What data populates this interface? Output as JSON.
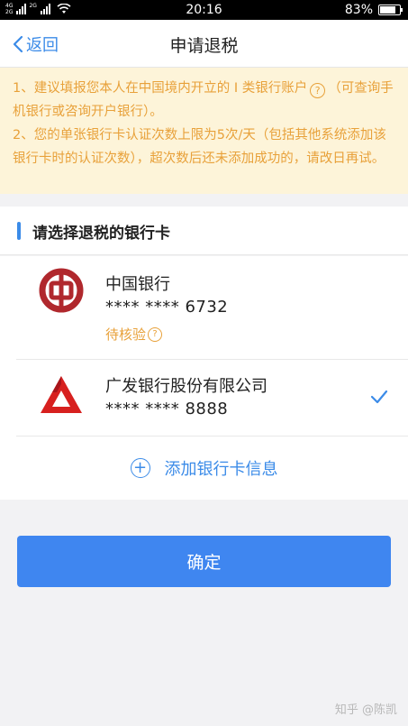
{
  "status_bar": {
    "network_top": "4G",
    "network_bottom": "2G",
    "network2_top": "2G",
    "time": "20:16",
    "battery_percent": "83%",
    "battery_level": 0.83
  },
  "nav": {
    "back_label": "返回",
    "title": "申请退税"
  },
  "notice": {
    "line1_a": "1、建议填报您本人在中国境内开立的 I 类银行账户",
    "line1_icon": "?",
    "line1_b": "（可查询手机银行或咨询开户银行）。",
    "line2": "2、您的单张银行卡认证次数上限为5次/天（包括其他系统添加该银行卡时的认证次数），超次数后还未添加成功的，请改日再试。"
  },
  "section": {
    "title": "请选择退税的银行卡"
  },
  "cards": [
    {
      "bank_name": "中国银行",
      "number": "**** **** 6732",
      "status": "待核验",
      "status_icon": "?",
      "logo_icon": "boc-logo-icon",
      "selected": false
    },
    {
      "bank_name": "广发银行股份有限公司",
      "number": "**** **** 8888",
      "logo_icon": "cgb-logo-icon",
      "selected": true
    }
  ],
  "add_card_label": "添加银行卡信息",
  "confirm_label": "确定",
  "watermark": "知乎 @陈凯",
  "colors": {
    "accent": "#3b8be8",
    "warning_text": "#e8a13a",
    "notice_bg": "#fdf4d9",
    "button": "#3f86f0",
    "boc_red": "#b0282d",
    "cgb_red": "#d7201f"
  }
}
